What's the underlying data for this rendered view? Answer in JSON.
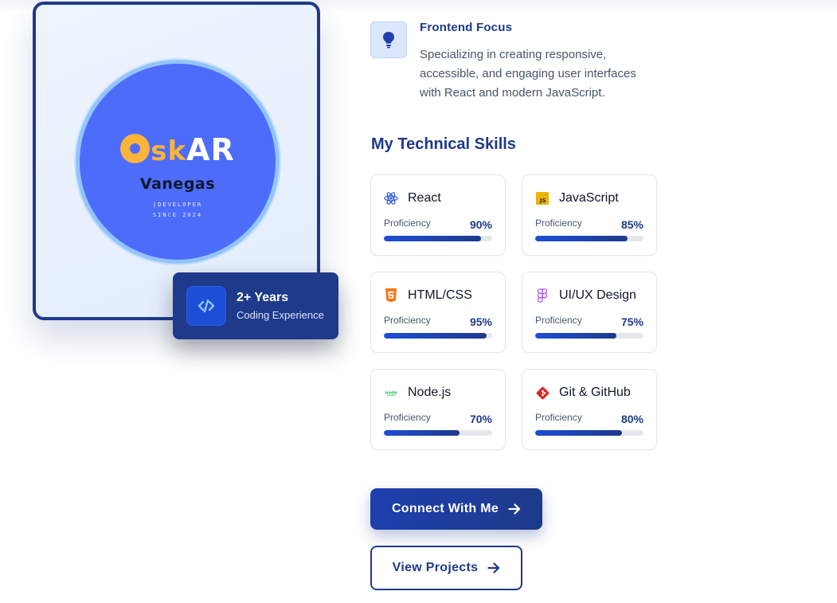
{
  "profile": {
    "logo": {
      "main_prefix": "O",
      "main_sk": "sk",
      "main_suffix": "AR",
      "sub": "Vanegas",
      "tag1": "|DEVELOPER",
      "tag2": "SINCE 2024"
    },
    "experience": {
      "title": "2+ Years",
      "subtitle": "Coding Experience",
      "icon": "code-icon"
    }
  },
  "focus": {
    "icon": "lightbulb-icon",
    "title": "Frontend Focus",
    "description": "Specializing in creating responsive, accessible, and engaging user interfaces with React and modern JavaScript."
  },
  "skills": {
    "heading": "My Technical Skills",
    "proficiency_label": "Proficiency",
    "items": [
      {
        "name": "React",
        "icon": "react-icon",
        "value": "90%",
        "percent": 90,
        "color": "#1d4ed8"
      },
      {
        "name": "JavaScript",
        "icon": "javascript-icon",
        "value": "85%",
        "percent": 85,
        "color": "#eab308"
      },
      {
        "name": "HTML/CSS",
        "icon": "html5-icon",
        "value": "95%",
        "percent": 95,
        "color": "#f97316"
      },
      {
        "name": "UI/UX Design",
        "icon": "figma-icon",
        "value": "75%",
        "percent": 75,
        "color": "#a855f7"
      },
      {
        "name": "Node.js",
        "icon": "nodejs-icon",
        "value": "70%",
        "percent": 70,
        "color": "#22c55e"
      },
      {
        "name": "Git & GitHub",
        "icon": "git-icon",
        "value": "80%",
        "percent": 80,
        "color": "#dc2626"
      }
    ]
  },
  "actions": {
    "connect_label": "Connect With Me",
    "projects_label": "View Projects"
  },
  "colors": {
    "primary": "#1e3a8a",
    "accent": "#1d4ed8",
    "logo_blue": "#4d6cfa",
    "logo_orange": "#fbb43a"
  }
}
